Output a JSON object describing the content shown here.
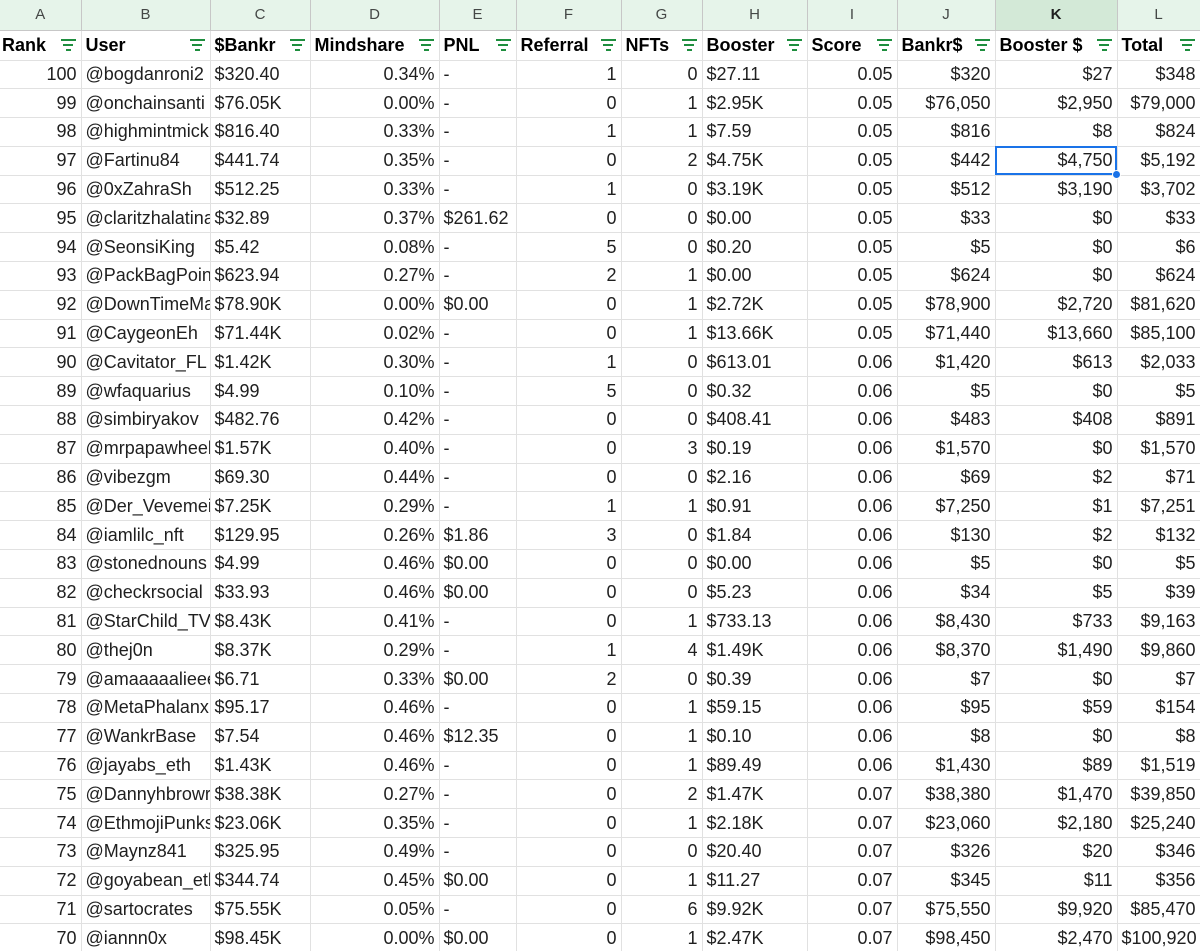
{
  "sheet": {
    "column_letters": [
      "A",
      "B",
      "C",
      "D",
      "E",
      "F",
      "G",
      "H",
      "I",
      "J",
      "K",
      "L"
    ],
    "selected_column": "K",
    "headers": [
      "Rank",
      "User",
      "$Bankr",
      "Mindshare",
      "PNL",
      "Referral",
      "NFTs",
      "Booster",
      "Score",
      "Bankr$",
      "Booster $",
      "Total"
    ],
    "active_cell": {
      "row": 3,
      "col": 10
    },
    "rows": [
      [
        "100",
        "@bogdanroni2",
        "$320.40",
        "0.34%",
        "-",
        "1",
        "0",
        "$27.11",
        "0.05",
        "$320",
        "$27",
        "$348"
      ],
      [
        "99",
        "@onchainsanti",
        "$76.05K",
        "0.00%",
        "-",
        "0",
        "1",
        "$2.95K",
        "0.05",
        "$76,050",
        "$2,950",
        "$79,000"
      ],
      [
        "98",
        "@highmintmick",
        "$816.40",
        "0.33%",
        "-",
        "1",
        "1",
        "$7.59",
        "0.05",
        "$816",
        "$8",
        "$824"
      ],
      [
        "97",
        "@Fartinu84",
        "$441.74",
        "0.35%",
        "-",
        "0",
        "2",
        "$4.75K",
        "0.05",
        "$442",
        "$4,750",
        "$5,192"
      ],
      [
        "96",
        "@0xZahraSh",
        "$512.25",
        "0.33%",
        "-",
        "1",
        "0",
        "$3.19K",
        "0.05",
        "$512",
        "$3,190",
        "$3,702"
      ],
      [
        "95",
        "@claritzhalatina",
        "$32.89",
        "0.37%",
        "$261.62",
        "0",
        "0",
        "$0.00",
        "0.05",
        "$33",
        "$0",
        "$33"
      ],
      [
        "94",
        "@SeonsiKing",
        "$5.42",
        "0.08%",
        "-",
        "5",
        "0",
        "$0.20",
        "0.05",
        "$5",
        "$0",
        "$6"
      ],
      [
        "93",
        "@PackBagPoin",
        "$623.94",
        "0.27%",
        "-",
        "2",
        "1",
        "$0.00",
        "0.05",
        "$624",
        "$0",
        "$624"
      ],
      [
        "92",
        "@DownTimeMa",
        "$78.90K",
        "0.00%",
        "$0.00",
        "0",
        "1",
        "$2.72K",
        "0.05",
        "$78,900",
        "$2,720",
        "$81,620"
      ],
      [
        "91",
        "@CaygeonEh",
        "$71.44K",
        "0.02%",
        "-",
        "0",
        "1",
        "$13.66K",
        "0.05",
        "$71,440",
        "$13,660",
        "$85,100"
      ],
      [
        "90",
        "@Cavitator_FL",
        "$1.42K",
        "0.30%",
        "-",
        "1",
        "0",
        "$613.01",
        "0.06",
        "$1,420",
        "$613",
        "$2,033"
      ],
      [
        "89",
        "@wfaquarius",
        "$4.99",
        "0.10%",
        "-",
        "5",
        "0",
        "$0.32",
        "0.06",
        "$5",
        "$0",
        "$5"
      ],
      [
        "88",
        "@simbiryakov",
        "$482.76",
        "0.42%",
        "-",
        "0",
        "0",
        "$408.41",
        "0.06",
        "$483",
        "$408",
        "$891"
      ],
      [
        "87",
        "@mrpapawheel",
        "$1.57K",
        "0.40%",
        "-",
        "0",
        "3",
        "$0.19",
        "0.06",
        "$1,570",
        "$0",
        "$1,570"
      ],
      [
        "86",
        "@vibezgm",
        "$69.30",
        "0.44%",
        "-",
        "0",
        "0",
        "$2.16",
        "0.06",
        "$69",
        "$2",
        "$71"
      ],
      [
        "85",
        "@Der_Vevemei",
        "$7.25K",
        "0.29%",
        "-",
        "1",
        "1",
        "$0.91",
        "0.06",
        "$7,250",
        "$1",
        "$7,251"
      ],
      [
        "84",
        "@iamlilc_nft",
        "$129.95",
        "0.26%",
        "$1.86",
        "3",
        "0",
        "$1.84",
        "0.06",
        "$130",
        "$2",
        "$132"
      ],
      [
        "83",
        "@stonednouns",
        "$4.99",
        "0.46%",
        "$0.00",
        "0",
        "0",
        "$0.00",
        "0.06",
        "$5",
        "$0",
        "$5"
      ],
      [
        "82",
        "@checkrsocial",
        "$33.93",
        "0.46%",
        "$0.00",
        "0",
        "0",
        "$5.23",
        "0.06",
        "$34",
        "$5",
        "$39"
      ],
      [
        "81",
        "@StarChild_TV",
        "$8.43K",
        "0.41%",
        "-",
        "0",
        "1",
        "$733.13",
        "0.06",
        "$8,430",
        "$733",
        "$9,163"
      ],
      [
        "80",
        "@thej0n",
        "$8.37K",
        "0.29%",
        "-",
        "1",
        "4",
        "$1.49K",
        "0.06",
        "$8,370",
        "$1,490",
        "$9,860"
      ],
      [
        "79",
        "@amaaaaalieee",
        "$6.71",
        "0.33%",
        "$0.00",
        "2",
        "0",
        "$0.39",
        "0.06",
        "$7",
        "$0",
        "$7"
      ],
      [
        "78",
        "@MetaPhalanx",
        "$95.17",
        "0.46%",
        "-",
        "0",
        "1",
        "$59.15",
        "0.06",
        "$95",
        "$59",
        "$154"
      ],
      [
        "77",
        "@WankrBase",
        "$7.54",
        "0.46%",
        "$12.35",
        "0",
        "1",
        "$0.10",
        "0.06",
        "$8",
        "$0",
        "$8"
      ],
      [
        "76",
        "@jayabs_eth",
        "$1.43K",
        "0.46%",
        "-",
        "0",
        "1",
        "$89.49",
        "0.06",
        "$1,430",
        "$89",
        "$1,519"
      ],
      [
        "75",
        "@Dannyhbrowr",
        "$38.38K",
        "0.27%",
        "-",
        "0",
        "2",
        "$1.47K",
        "0.07",
        "$38,380",
        "$1,470",
        "$39,850"
      ],
      [
        "74",
        "@EthmojiPunks",
        "$23.06K",
        "0.35%",
        "-",
        "0",
        "1",
        "$2.18K",
        "0.07",
        "$23,060",
        "$2,180",
        "$25,240"
      ],
      [
        "73",
        "@Maynz841",
        "$325.95",
        "0.49%",
        "-",
        "0",
        "0",
        "$20.40",
        "0.07",
        "$326",
        "$20",
        "$346"
      ],
      [
        "72",
        "@goyabean_eth",
        "$344.74",
        "0.45%",
        "$0.00",
        "0",
        "1",
        "$11.27",
        "0.07",
        "$345",
        "$11",
        "$356"
      ],
      [
        "71",
        "@sartocrates",
        "$75.55K",
        "0.05%",
        "-",
        "0",
        "6",
        "$9.92K",
        "0.07",
        "$75,550",
        "$9,920",
        "$85,470"
      ],
      [
        "70",
        "@iannn0x",
        "$98.45K",
        "0.00%",
        "$0.00",
        "0",
        "1",
        "$2.47K",
        "0.07",
        "$98,450",
        "$2,470",
        "$100,920"
      ]
    ]
  },
  "colors": {
    "header_band": "#e6f4ea",
    "selected_header_band": "#d3e9d7",
    "filter_icon": "#1e8e3e",
    "selection": "#1a73e8",
    "gridline": "#e1e1e1"
  }
}
